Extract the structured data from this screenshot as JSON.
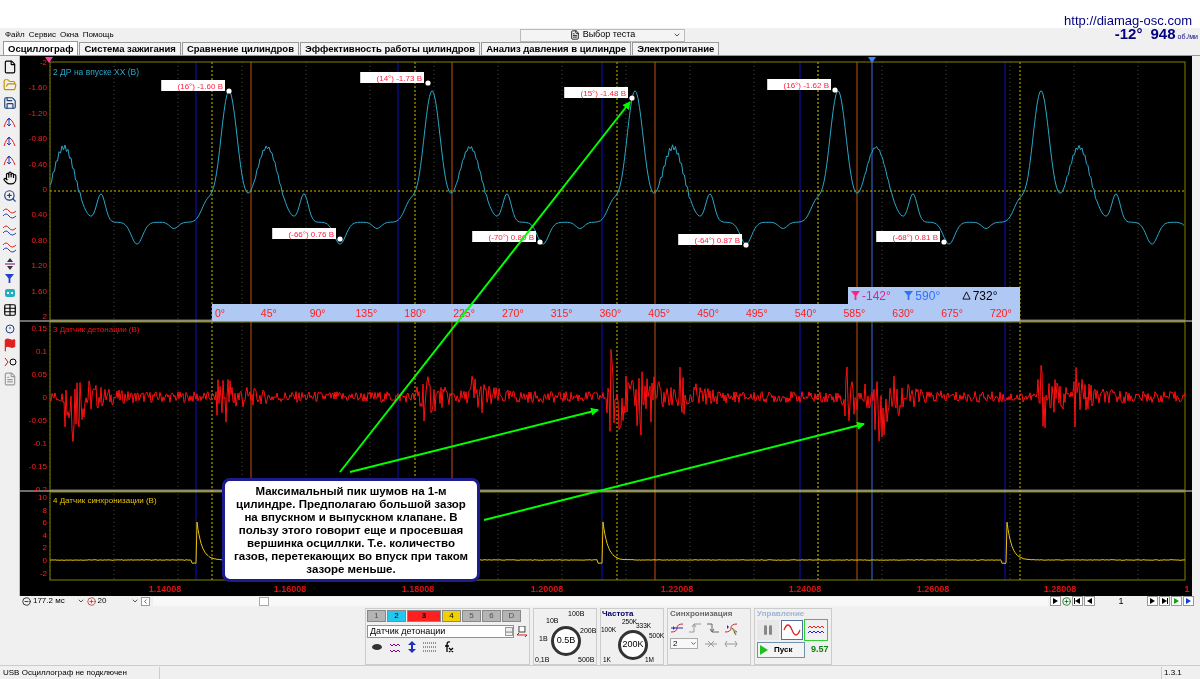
{
  "header": {
    "url": "http://diamag-osc.com",
    "angle": "-12°",
    "rpm": "948",
    "rpm_unit": "об./ми"
  },
  "menu": [
    "Файл",
    "Сервис",
    "Окна",
    "Помощь"
  ],
  "test_select": {
    "value": "Выбор теста"
  },
  "tabs": [
    {
      "label": "Осциллограф",
      "selected": true
    },
    {
      "label": "Система зажигания",
      "selected": false
    },
    {
      "label": "Сравнение цилиндров",
      "selected": false
    },
    {
      "label": "Эффективность работы цилиндров",
      "selected": false
    },
    {
      "label": "Анализ давления в цилиндре",
      "selected": false
    },
    {
      "label": "Электропитание",
      "selected": false
    }
  ],
  "channels": [
    {
      "title": "2 ДР на впуске ХХ (В)",
      "color": "#2aa6c8",
      "yticks": [
        "-2",
        "-1.60",
        "-1.20",
        "-0.80",
        "-0.40",
        "0",
        "0.40",
        "0.80",
        "1.20",
        "1.60",
        "2"
      ],
      "markers": [
        "(16°) -1.60 В",
        "(-66°) 0.76 В",
        "(14°) -1.73 В",
        "(-70°) 0.80 В",
        "(15°) -1.48 В",
        "(-64°) 0.87 В",
        "(16°) -1.62 В",
        "(-68°) 0.81 В"
      ]
    },
    {
      "title": "3 Датчик детонации (В)",
      "color": "#ff1010",
      "yticks": [
        "0.15",
        "0.1",
        "0.05",
        "0",
        "-0.05",
        "-0.1",
        "-0.15",
        "-0.2"
      ]
    },
    {
      "title": "4 Датчик синхронизации (В)",
      "color": "#e8c400",
      "yticks": [
        "10",
        "8",
        "6",
        "4",
        "2",
        "0",
        "-2"
      ]
    }
  ],
  "angle_scale": [
    "0°",
    "45°",
    "90°",
    "135°",
    "180°",
    "225°",
    "270°",
    "315°",
    "360°",
    "405°",
    "450°",
    "495°",
    "540°",
    "585°",
    "630°",
    "675°",
    "720°"
  ],
  "cursors": [
    {
      "kind": "start",
      "value": "-142°"
    },
    {
      "kind": "end",
      "value": "590°"
    },
    {
      "kind": "delta",
      "value": "732°"
    }
  ],
  "time_axis": [
    "1.14008",
    "1.16008",
    "1.18008",
    "1.20008",
    "1.22008",
    "1.24008",
    "1.26008",
    "1.28008",
    "1"
  ],
  "callout": "Максимальный пик шумов на 1-м цилиндре. Предполагаю большой зазор на впускном и выпускном клапане. В пользу этого говорит еще и просевшая вершинка осциллки. Т.е. количество газов, перетекающих во впуск при таком зазоре меньше.",
  "zoom": {
    "time": "177.2 мс",
    "count": "20"
  },
  "page": "1",
  "channel_buttons": [
    {
      "label": "1",
      "color": "#b4b4b4",
      "selected": false,
      "disabled": true
    },
    {
      "label": "2",
      "color": "#22c8f0",
      "selected": false,
      "disabled": false
    },
    {
      "label": "3",
      "color": "#ff2020",
      "selected": true,
      "disabled": false
    },
    {
      "label": "4",
      "color": "#f0d000",
      "selected": false,
      "disabled": false
    },
    {
      "label": "5",
      "color": "#b4b4b4",
      "selected": false,
      "disabled": true
    },
    {
      "label": "6",
      "color": "#b4b4b4",
      "selected": false,
      "disabled": true
    },
    {
      "label": "D",
      "color": "#b4b4b4",
      "selected": false,
      "disabled": true
    }
  ],
  "channel_name": "Датчик детонации",
  "voltage": {
    "value": "0.5В",
    "ticks": [
      "0,1В",
      "1В",
      "10В",
      "100В",
      "200В",
      "500В"
    ]
  },
  "frequency": {
    "title": "Частота",
    "value": "200K",
    "ticks": [
      "1K",
      "100K",
      "250K",
      "333K",
      "500K",
      "1M"
    ]
  },
  "sync": {
    "title": "Синхронизация",
    "channel": "2"
  },
  "control": {
    "title": "Управление",
    "modes": [
      {
        "kind": "pause",
        "selected": false
      },
      {
        "kind": "sine",
        "selected": true
      },
      {
        "kind": "multi",
        "selected": false
      }
    ],
    "start": "Пуск",
    "reading": "9.57"
  },
  "status": {
    "text": "USB Осциллограф не подключен",
    "version": "1.3.1"
  }
}
